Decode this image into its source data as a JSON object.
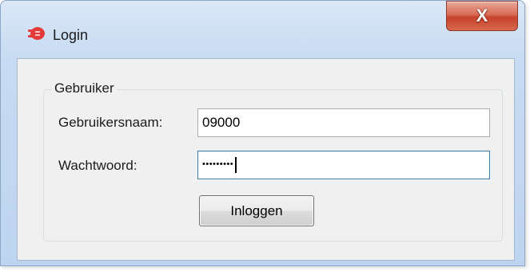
{
  "window": {
    "title": "Login",
    "close_glyph": "X",
    "app_icon": "red-plug-icon",
    "accent_color": "#c7412b"
  },
  "group": {
    "legend": "Gebruiker"
  },
  "form": {
    "username_label": "Gebruikersnaam:",
    "username_value": "09000",
    "password_label": "Wachtwoord:",
    "password_masked": "•••••••••",
    "login_button": "Inloggen"
  }
}
